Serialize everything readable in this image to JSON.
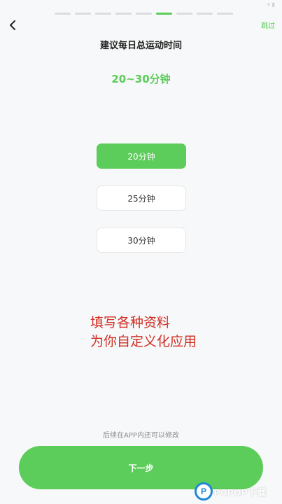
{
  "status_bar": {
    "icons": [
      "signal-icon",
      "battery-icon"
    ]
  },
  "progress": {
    "total_steps": 9,
    "current_step": 6
  },
  "header": {
    "skip_label": "跳过"
  },
  "title": "建议每日总运动时间",
  "selected_range": "20~30分钟",
  "options": [
    {
      "label": "20分钟",
      "selected": true
    },
    {
      "label": "25分钟",
      "selected": false
    },
    {
      "label": "30分钟",
      "selected": false
    }
  ],
  "overlay": {
    "line1": "填写各种资料",
    "line2": "为你自定义化应用"
  },
  "hint": "后续在APP内还可以修改",
  "next_label": "下一步",
  "watermark": {
    "text": "PCPOP下载",
    "mark": "P"
  },
  "colors": {
    "accent": "#5ccc5a",
    "overlay_text": "#d02f24",
    "background": "#f7f8f9"
  }
}
